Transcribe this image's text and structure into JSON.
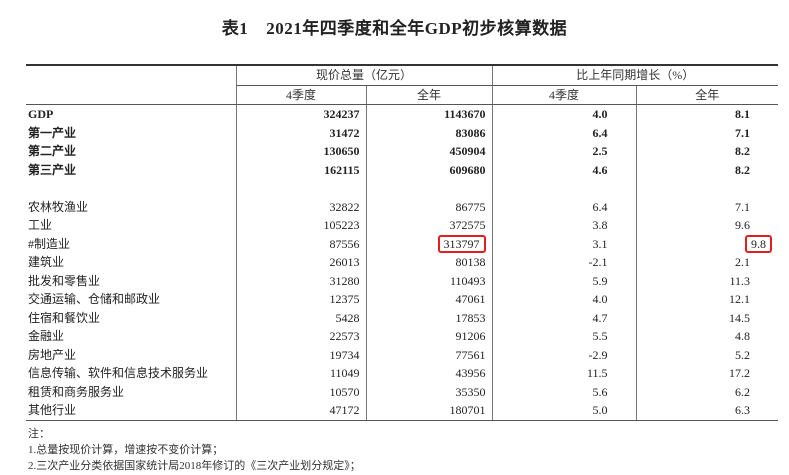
{
  "title": {
    "number": "表1",
    "text": "2021年四季度和全年GDP初步核算数据"
  },
  "header": {
    "group1": "现价总量（亿元）",
    "group2": "比上年同期增长（%）",
    "q4": "4季度",
    "year": "全年"
  },
  "bold_rows": [
    {
      "name": "GDP",
      "q4_total": "324237",
      "year_total": "1143670",
      "q4_growth": "4.0",
      "year_growth": "8.1"
    },
    {
      "name": "第一产业",
      "q4_total": "31472",
      "year_total": "83086",
      "q4_growth": "6.4",
      "year_growth": "7.1"
    },
    {
      "name": "第二产业",
      "q4_total": "130650",
      "year_total": "450904",
      "q4_growth": "2.5",
      "year_growth": "8.2"
    },
    {
      "name": "第三产业",
      "q4_total": "162115",
      "year_total": "609680",
      "q4_growth": "4.6",
      "year_growth": "8.2"
    }
  ],
  "rows": [
    {
      "name": "农林牧渔业",
      "q4_total": "32822",
      "year_total": "86775",
      "q4_growth": "6.4",
      "year_growth": "7.1"
    },
    {
      "name": "工业",
      "q4_total": "105223",
      "year_total": "372575",
      "q4_growth": "3.8",
      "year_growth": "9.6"
    },
    {
      "name": "#制造业",
      "q4_total": "87556",
      "year_total": "313797",
      "q4_growth": "3.1",
      "year_growth": "9.8"
    },
    {
      "name": "建筑业",
      "q4_total": "26013",
      "year_total": "80138",
      "q4_growth": "-2.1",
      "year_growth": "2.1"
    },
    {
      "name": "批发和零售业",
      "q4_total": "31280",
      "year_total": "110493",
      "q4_growth": "5.9",
      "year_growth": "11.3"
    },
    {
      "name": "交通运输、仓储和邮政业",
      "q4_total": "12375",
      "year_total": "47061",
      "q4_growth": "4.0",
      "year_growth": "12.1"
    },
    {
      "name": "住宿和餐饮业",
      "q4_total": "5428",
      "year_total": "17853",
      "q4_growth": "4.7",
      "year_growth": "14.5"
    },
    {
      "name": "金融业",
      "q4_total": "22573",
      "year_total": "91206",
      "q4_growth": "5.5",
      "year_growth": "4.8"
    },
    {
      "name": "房地产业",
      "q4_total": "19734",
      "year_total": "77561",
      "q4_growth": "-2.9",
      "year_growth": "5.2"
    },
    {
      "name": "信息传输、软件和信息技术服务业",
      "q4_total": "11049",
      "year_total": "43956",
      "q4_growth": "11.5",
      "year_growth": "17.2"
    },
    {
      "name": "租赁和商务服务业",
      "q4_total": "10570",
      "year_total": "35350",
      "q4_growth": "5.6",
      "year_growth": "6.2"
    },
    {
      "name": "其他行业",
      "q4_total": "47172",
      "year_total": "180701",
      "q4_growth": "5.0",
      "year_growth": "6.3"
    }
  ],
  "notes": {
    "label": "注：",
    "line1": "1.总量按现价计算，增速按不变价计算；",
    "line2": "2.三次产业分类依据国家统计局2018年修订的《三次产业划分规定》；"
  },
  "highlight_color": "#e02020"
}
